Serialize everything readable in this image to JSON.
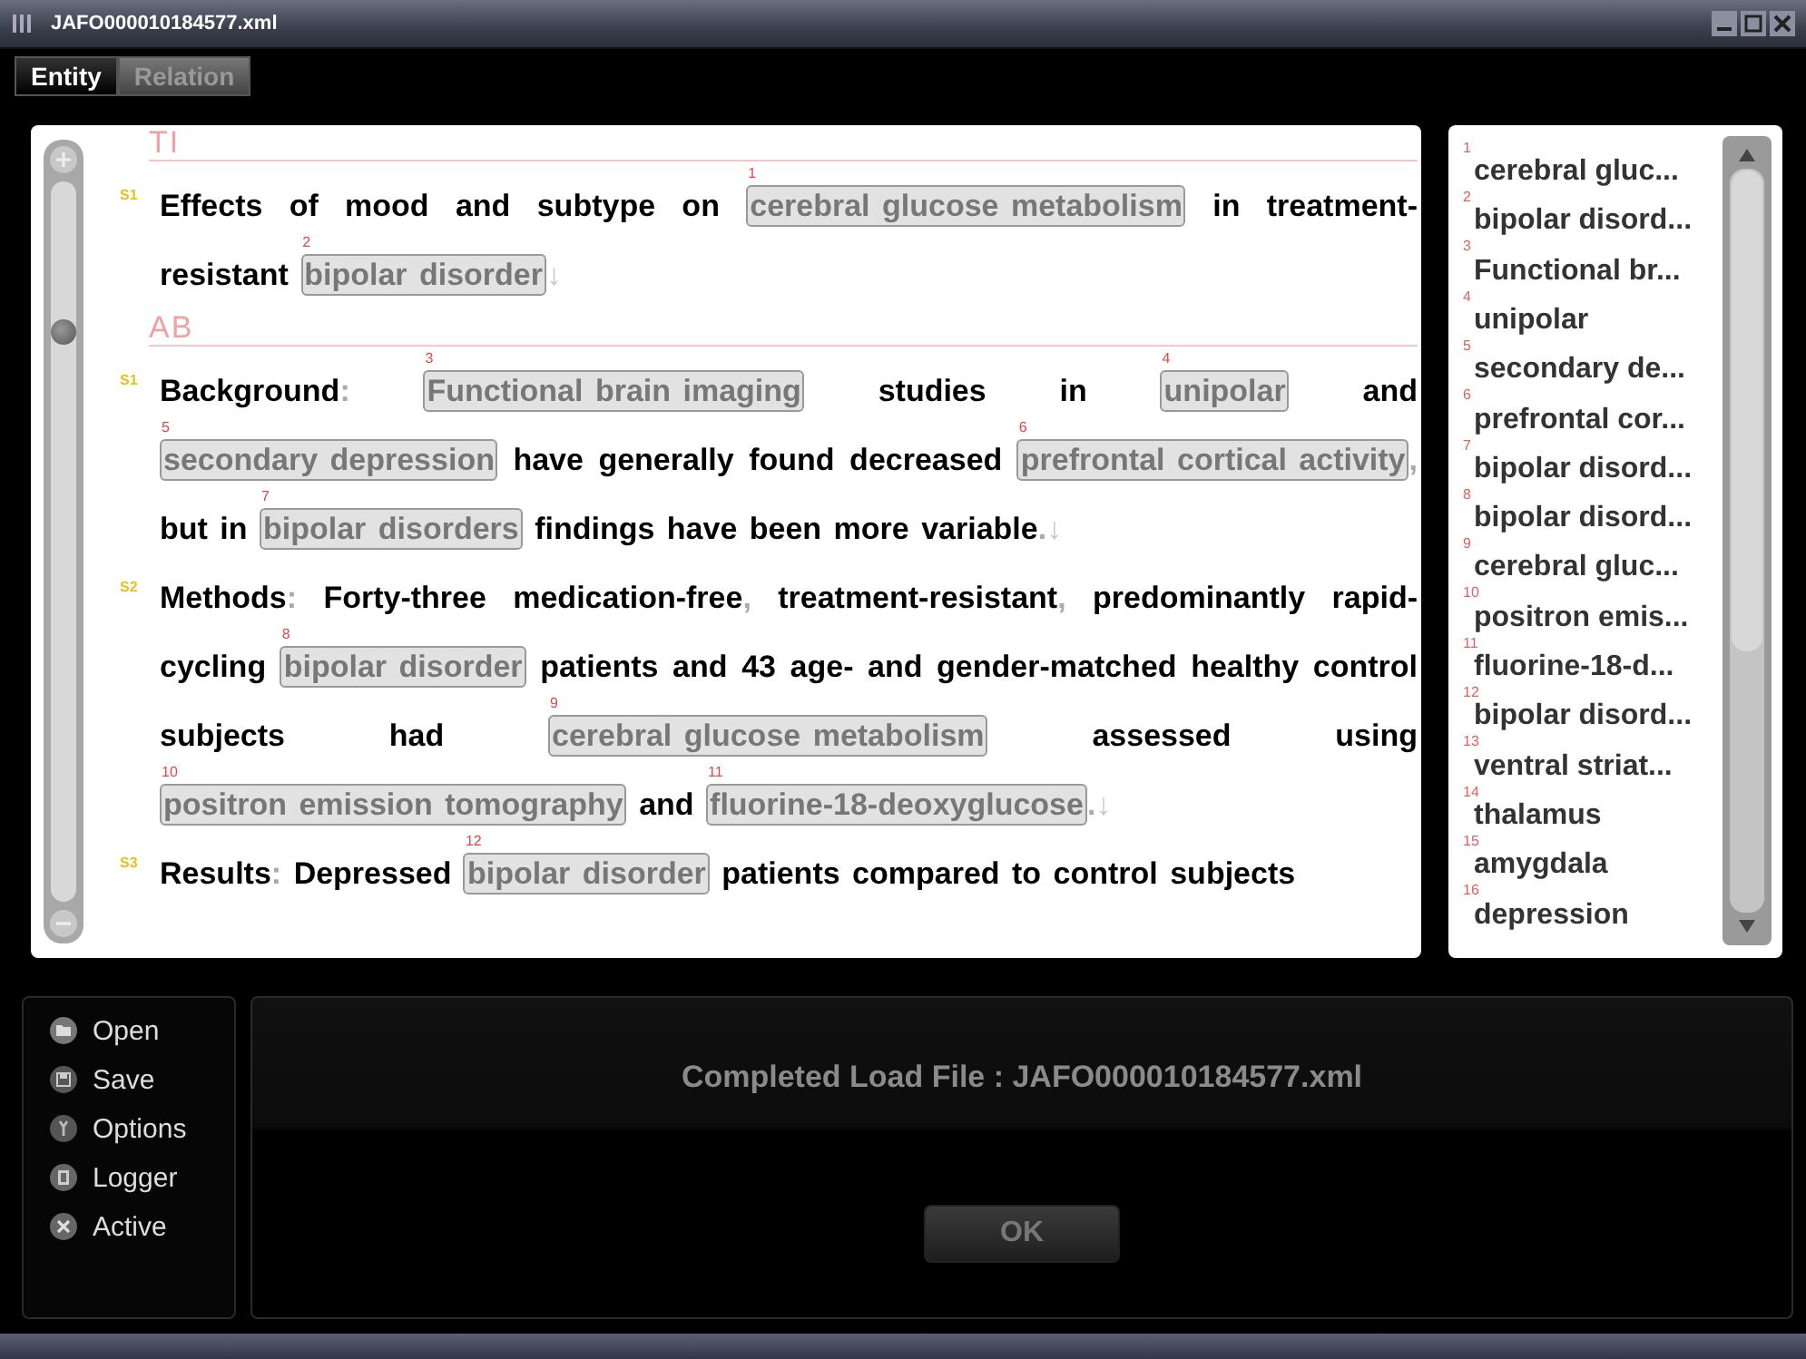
{
  "window": {
    "title": "JAFO000010184577.xml"
  },
  "tabs": [
    {
      "label": "Entity",
      "selected": true
    },
    {
      "label": "Relation",
      "selected": false
    }
  ],
  "document": {
    "sections": [
      {
        "label": "TI",
        "sentences": [
          {
            "marker": "S1",
            "segments": [
              {
                "kind": "text",
                "text": "Effects of mood and subtype on "
              },
              {
                "kind": "entity",
                "number": "1",
                "text": "cerebral glucose metabolism"
              },
              {
                "kind": "text",
                "text": " in treatment-resistant "
              },
              {
                "kind": "entity",
                "number": "2",
                "text": "bipolar disorder"
              },
              {
                "kind": "end",
                "text": "↓"
              }
            ]
          }
        ]
      },
      {
        "label": "AB",
        "sentences": [
          {
            "marker": "S1",
            "segments": [
              {
                "kind": "text",
                "text": "Background"
              },
              {
                "kind": "punct",
                "text": ": "
              },
              {
                "kind": "entity",
                "number": "3",
                "text": "Functional brain imaging"
              },
              {
                "kind": "text",
                "text": " studies in "
              },
              {
                "kind": "entity",
                "number": "4",
                "text": "unipolar"
              },
              {
                "kind": "text",
                "text": " and "
              },
              {
                "kind": "entity",
                "number": "5",
                "text": "secondary depression"
              },
              {
                "kind": "text",
                "text": " have generally found decreased "
              },
              {
                "kind": "entity",
                "number": "6",
                "text": "prefrontal cortical activity"
              },
              {
                "kind": "punct",
                "text": ","
              },
              {
                "kind": "text",
                "text": " but in "
              },
              {
                "kind": "entity",
                "number": "7",
                "text": "bipolar disorders"
              },
              {
                "kind": "text",
                "text": " findings have been more variable"
              },
              {
                "kind": "punct",
                "text": "."
              },
              {
                "kind": "end",
                "text": "↓"
              }
            ]
          },
          {
            "marker": "S2",
            "segments": [
              {
                "kind": "text",
                "text": "Methods"
              },
              {
                "kind": "punct",
                "text": ":"
              },
              {
                "kind": "text",
                "text": " Forty-three medication-free"
              },
              {
                "kind": "punct",
                "text": ","
              },
              {
                "kind": "text",
                "text": " treatment-resistant"
              },
              {
                "kind": "punct",
                "text": ","
              },
              {
                "kind": "text",
                "text": " predominantly rapid-cycling "
              },
              {
                "kind": "entity",
                "number": "8",
                "text": "bipolar disorder"
              },
              {
                "kind": "text",
                "text": " patients and 43 age- and gender-matched healthy control subjects had "
              },
              {
                "kind": "entity",
                "number": "9",
                "text": "cerebral glucose metabolism"
              },
              {
                "kind": "text",
                "text": " assessed using "
              },
              {
                "kind": "entity",
                "number": "10",
                "text": "positron emission tomography"
              },
              {
                "kind": "text",
                "text": " and "
              },
              {
                "kind": "entity",
                "number": "11",
                "text": "fluorine-18-deoxyglucose"
              },
              {
                "kind": "punct",
                "text": "."
              },
              {
                "kind": "end",
                "text": "↓"
              }
            ]
          },
          {
            "marker": "S3",
            "segments": [
              {
                "kind": "text",
                "text": "Results"
              },
              {
                "kind": "punct",
                "text": ":"
              },
              {
                "kind": "text",
                "text": " Depressed "
              },
              {
                "kind": "entity",
                "number": "12",
                "text": "bipolar disorder"
              },
              {
                "kind": "text",
                "text": " patients compared to control subjects"
              }
            ]
          }
        ]
      }
    ]
  },
  "entity_list": {
    "items": [
      {
        "number": "1",
        "text": "cerebral gluc..."
      },
      {
        "number": "2",
        "text": "bipolar disord..."
      },
      {
        "number": "3",
        "text": "Functional br..."
      },
      {
        "number": "4",
        "text": "unipolar"
      },
      {
        "number": "5",
        "text": "secondary de..."
      },
      {
        "number": "6",
        "text": "prefrontal cor..."
      },
      {
        "number": "7",
        "text": "bipolar disord..."
      },
      {
        "number": "8",
        "text": "bipolar disord..."
      },
      {
        "number": "9",
        "text": "cerebral gluc..."
      },
      {
        "number": "10",
        "text": "positron emis..."
      },
      {
        "number": "11",
        "text": "fluorine-18-d..."
      },
      {
        "number": "12",
        "text": "bipolar disord..."
      },
      {
        "number": "13",
        "text": "ventral striat..."
      },
      {
        "number": "14",
        "text": "thalamus"
      },
      {
        "number": "15",
        "text": "amygdala"
      },
      {
        "number": "16",
        "text": "depression"
      }
    ]
  },
  "menu": {
    "items": [
      {
        "kind": "open",
        "label": "Open"
      },
      {
        "kind": "save",
        "label": "Save"
      },
      {
        "kind": "options",
        "label": "Options"
      },
      {
        "kind": "logger",
        "label": "Logger"
      },
      {
        "kind": "active",
        "label": "Active"
      }
    ]
  },
  "status": {
    "message": "Completed Load File : JAFO000010184577.xml",
    "button": "OK"
  }
}
